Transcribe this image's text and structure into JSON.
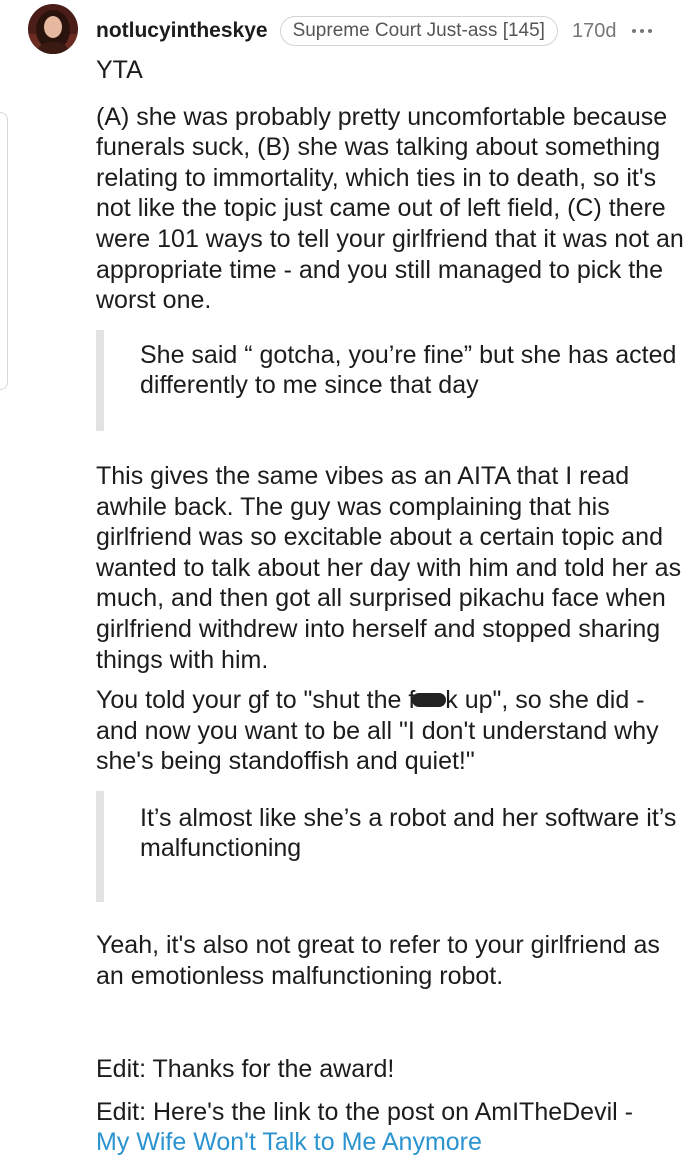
{
  "post": {
    "username": "notlucyintheskye",
    "flair": "Supreme Court Just-ass [145]",
    "age": "170d",
    "verdict": "YTA",
    "paragraph1": "(A) she was probably pretty uncomfortable because funerals suck, (B) she was talking about something relating to immortality, which ties in to death, so it's not like the topic just came out of left field, (C) there were 101 ways to tell your girlfriend that it was not an appropriate time - and you still managed to pick the worst one.",
    "quote1": "She said “ gotcha, you’re fine” but she has acted differently to me since that day",
    "paragraph2": "This gives the same vibes as an AITA that I read awhile back. The guy was complaining that his girlfriend was so excitable about a certain topic and wanted to talk about her day with him and told her as much, and then got all surprised pikachu face when girlfriend withdrew into herself and stopped sharing things with him.",
    "paragraph3_start": "You told your gf to \"shut the f",
    "paragraph3_end": "k up\", so she did - and now you want to be all \"I don't understand why she's being standoffish and quiet!\"",
    "quote2": "It’s almost like she’s a robot and her software it’s malfunctioning",
    "paragraph4": "Yeah, it's also not great to refer to your girlfriend as an emotionless malfunctioning robot.",
    "edit1": "Edit: Thanks for the award!",
    "edit2": "Edit: Here's the link to the post on AmITheDevil -",
    "link_text": "My Wife Won't Talk to Me Anymore"
  },
  "colors": {
    "text": "#1c1c1c",
    "muted": "#777777",
    "link": "#2a93d0",
    "quote_bar": "#e3e3e3"
  },
  "icons": {
    "more": "more-dots-icon",
    "avatar": "user-avatar"
  }
}
